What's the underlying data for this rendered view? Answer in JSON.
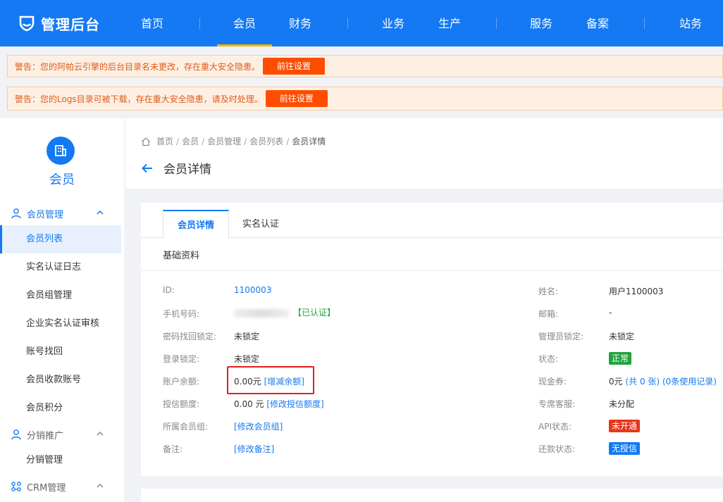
{
  "brand": {
    "name": "管理后台"
  },
  "nav": {
    "items": [
      {
        "label": "首页",
        "active": false
      },
      {
        "label": "会员",
        "active": true
      },
      {
        "label": "财务",
        "active": false
      },
      {
        "label": "业务",
        "active": false
      },
      {
        "label": "生产",
        "active": false
      },
      {
        "label": "服务",
        "active": false
      },
      {
        "label": "备案",
        "active": false
      },
      {
        "label": "站务",
        "active": false
      }
    ]
  },
  "alerts": [
    {
      "text": "警告：您的阿帕云引擎的后台目录名未更改，存在重大安全隐患。",
      "button": "前往设置"
    },
    {
      "text": "警告：您的Logs目录可被下载，存在重大安全隐患，请及时处理。",
      "button": "前往设置"
    }
  ],
  "sidebar": {
    "title": "会员",
    "icon": "building-icon",
    "groups": [
      {
        "label": "会员管理",
        "expanded": true,
        "icon": "user-icon",
        "items": [
          "会员列表",
          "实名认证日志",
          "会员组管理",
          "企业实名认证审核",
          "账号找回",
          "会员收款账号",
          "会员积分"
        ]
      },
      {
        "label": "分销推广",
        "expanded": true,
        "icon": "user-icon",
        "items": [
          "分销管理"
        ]
      },
      {
        "label": "CRM管理",
        "expanded": true,
        "icon": "crm-icon",
        "items": []
      }
    ],
    "active_item": "会员列表"
  },
  "breadcrumb": [
    "首页",
    "会员",
    "会员管理",
    "会员列表",
    "会员详情"
  ],
  "page_title": "会员详情",
  "tabs": [
    "会员详情",
    "实名认证"
  ],
  "section_title": "基础资料",
  "details": {
    "id_label": "ID:",
    "id_value": "1100003",
    "phone_label": "手机号码:",
    "phone_verified": "【已认证】",
    "pwd_lock_label": "密码找回锁定:",
    "pwd_lock_value": "未锁定",
    "login_lock_label": "登录锁定:",
    "login_lock_value": "未锁定",
    "balance_label": "账户余额:",
    "balance_value": "0.00元",
    "balance_link": "[增减余额]",
    "credit_label": "授信额度:",
    "credit_value": "0.00 元",
    "credit_link": "[修改授信额度]",
    "group_label": "所属会员组:",
    "group_link": "[修改会员组]",
    "remark_label": "备注:",
    "remark_link": "[修改备注]",
    "name_label": "姓名:",
    "name_value": "用户1100003",
    "email_label": "邮箱:",
    "email_value": "-",
    "admin_lock_label": "管理员锁定:",
    "admin_lock_value": "未锁定",
    "status_label": "状态:",
    "status_value": "正常",
    "coupon_label": "现金券:",
    "coupon_value": "0元",
    "coupon_count": "(共 0 张)",
    "coupon_records": "(0条使用记录)",
    "service_label": "专席客服:",
    "service_value": "未分配",
    "api_label": "API状态:",
    "api_value": "未开通",
    "repay_label": "还款状态:",
    "repay_value": "无授信"
  },
  "colors": {
    "primary": "#1479f2",
    "nav_active_underline": "#f7b500",
    "alert_btn": "#ff4d00",
    "status_ok": "#22a33d",
    "api_off": "#e8351b",
    "repay_blue": "#1479f2",
    "highlight": "#e02020"
  }
}
